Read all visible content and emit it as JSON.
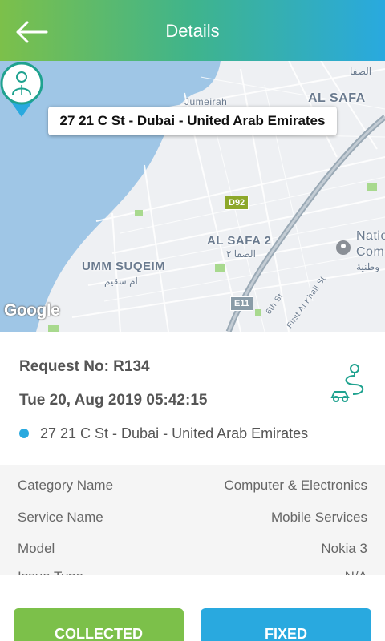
{
  "header": {
    "title": "Details",
    "back_icon": "arrow-left-icon"
  },
  "map": {
    "callout": "27 21 C St - Dubai - United Arab Emirates",
    "labels": {
      "jumeirah": "Jumeirah",
      "al_safa": "AL SAFA",
      "al_safa_ar": "الصفا",
      "al_safa_2": "AL SAFA 2",
      "al_safa_2_ar": "الصفا ٢",
      "umm_suqeim": "UMM SUQEIM",
      "umm_suqeim_ar": "ام سقيم",
      "national": "Natio",
      "national2": "Com",
      "national_ar": "وطنية",
      "d92": "D92",
      "e11": "E11",
      "sixth_st": "6th St",
      "first_al_khail": "First Al Khail St",
      "google": "Google"
    }
  },
  "request": {
    "number": "Request No: R134",
    "date": "Tue 20, Aug 2019 05:42:15",
    "address": "27 21 C St - Dubai - United Arab Emirates",
    "accent_color": "#29a9df"
  },
  "details": [
    {
      "label": "Category Name",
      "value": "Computer & Electronics"
    },
    {
      "label": "Service Name",
      "value": "Mobile Services"
    },
    {
      "label": "Model",
      "value": "Nokia 3"
    },
    {
      "label": "Issue Type",
      "value": "N/A"
    }
  ],
  "actions": {
    "collected": "COLLECTED",
    "fixed": "FIXED"
  },
  "colors": {
    "green": "#7cc04a",
    "blue": "#29a9df"
  }
}
